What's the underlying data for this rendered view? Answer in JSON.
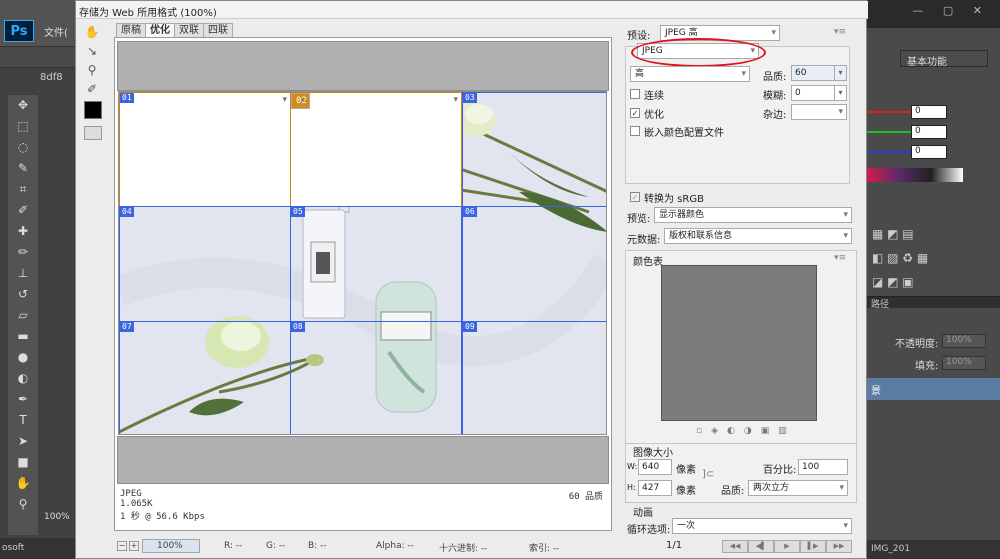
{
  "dialog": {
    "title": "存储为 Web 所用格式 (100%)",
    "tabs": [
      "原稿",
      "优化",
      "双联",
      "四联"
    ],
    "active_tab": "优化"
  },
  "photoshop": {
    "logo": "Ps",
    "menu_file": "文件(",
    "doc_tab": "8df8",
    "zoom": "100%",
    "bottom_text": "osoft"
  },
  "preview": {
    "slices": [
      "01",
      "02",
      "03",
      "04",
      "05",
      "06",
      "07",
      "08",
      "09"
    ],
    "selected_slice": "02",
    "info_format": "JPEG",
    "info_size": "1.065K",
    "info_speed": "1 秒 @ 56.6 Kbps",
    "info_quality": "60 品质"
  },
  "statusbar": {
    "zoom": "100%",
    "r": "R: --",
    "g": "G: --",
    "b": "B: --",
    "alpha": "Alpha: --",
    "hex": "十六进制: --",
    "index": "索引: --"
  },
  "settings": {
    "preset_label": "预设:",
    "preset_value": "JPEG 高",
    "format_value": "JPEG",
    "quality_preset": "高",
    "quality_label": "品质:",
    "quality_value": "60",
    "blur_label": "模糊:",
    "blur_value": "0",
    "matte_label": "杂边:",
    "progressive_label": "连续",
    "optimized_label": "优化",
    "embed_profile_label": "嵌入颜色配置文件",
    "convert_srgb_label": "转换为 sRGB",
    "preview_label": "预览:",
    "preview_value": "显示器颜色",
    "metadata_label": "元数据:",
    "metadata_value": "版权和联系信息",
    "color_table_label": "颜色表",
    "image_size_label": "图像大小",
    "w_label": "W:",
    "w_value": "640",
    "h_label": "H:",
    "h_value": "427",
    "unit": "像素",
    "percent_label": "百分比:",
    "percent_value": "100",
    "resample_label": "品质:",
    "resample_value": "两次立方",
    "animation_label": "动画",
    "loop_label": "循环选项:",
    "loop_value": "一次",
    "frame_counter": "1/1"
  },
  "right_panel": {
    "workspace": "基本功能",
    "rgb_values": [
      "0",
      "0",
      "0"
    ],
    "opacity_label": "不透明度:",
    "opacity_value": "100%",
    "fill_label": "填充:",
    "fill_value": "100%",
    "layer_tab": "路径",
    "layer_name": "景",
    "bottom_label": "IMG_201"
  },
  "colors": {
    "slice_line": "#3a65e0",
    "selected_slice": "#d08c1c",
    "annotation": "#e0141b"
  }
}
